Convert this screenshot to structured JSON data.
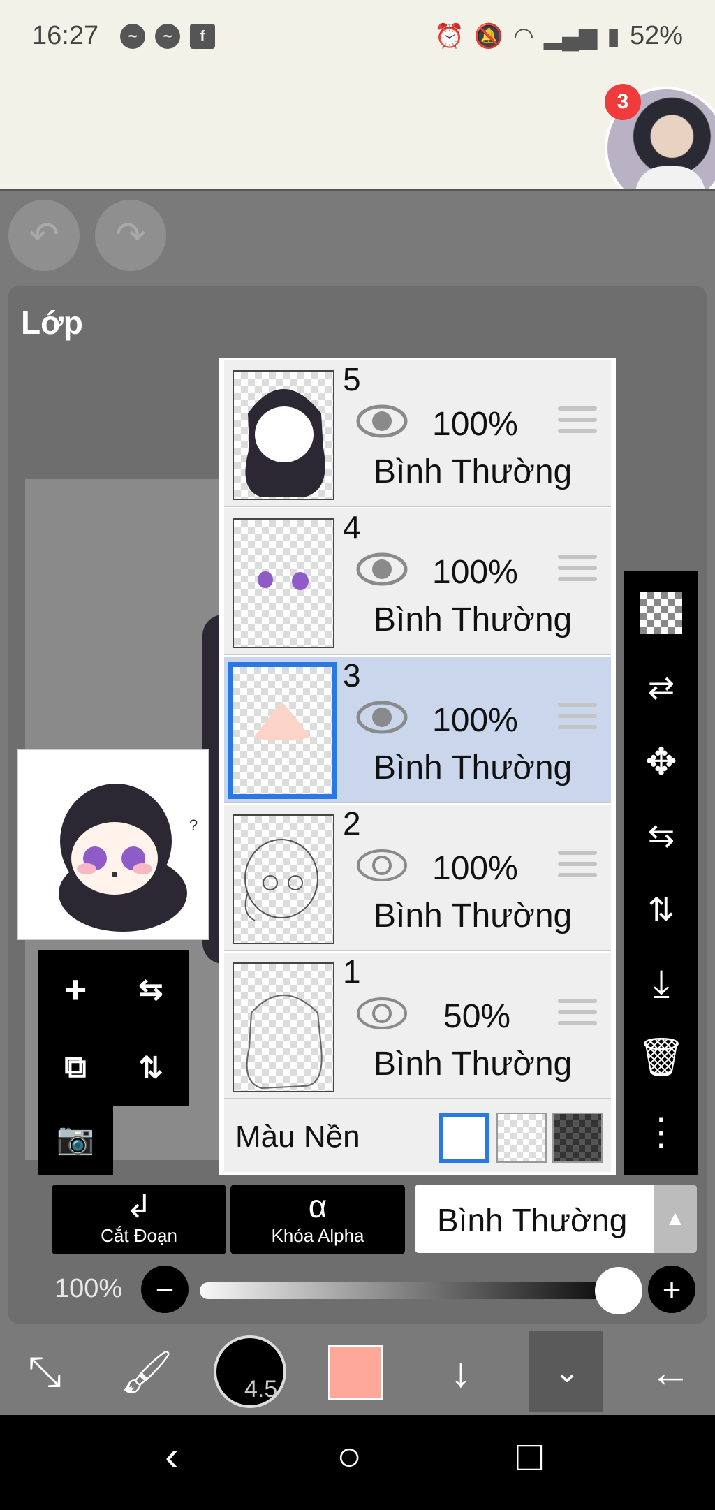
{
  "status_bar": {
    "time": "16:27",
    "left_icons": [
      "messenger-icon",
      "messenger-icon",
      "facebook-icon"
    ],
    "right_icons": [
      "alarm-icon",
      "mute-icon",
      "wifi-icon",
      "signal-icon",
      "battery-icon"
    ],
    "battery": "52%"
  },
  "chat_head": {
    "badge_count": "3"
  },
  "header": {
    "title": "Lớp"
  },
  "layers": [
    {
      "number": "5",
      "opacity": "100%",
      "blend": "Bình Thường",
      "visible": true,
      "selected": false
    },
    {
      "number": "4",
      "opacity": "100%",
      "blend": "Bình Thường",
      "visible": true,
      "selected": false
    },
    {
      "number": "3",
      "opacity": "100%",
      "blend": "Bình Thường",
      "visible": true,
      "selected": true
    },
    {
      "number": "2",
      "opacity": "100%",
      "blend": "Bình Thường",
      "visible": false,
      "selected": false
    },
    {
      "number": "1",
      "opacity": "50%",
      "blend": "Bình Thường",
      "visible": false,
      "selected": false
    }
  ],
  "background": {
    "label": "Màu Nền",
    "options": [
      "white",
      "transparent",
      "dark"
    ],
    "selected": "white"
  },
  "actions": {
    "clipping_label": "Cắt Đoạn",
    "alpha_lock_label": "Khóa Alpha",
    "blend_mode": "Bình Thường"
  },
  "opacity_slider": {
    "label": "100%",
    "value": 1.0
  },
  "brush": {
    "size": "4.5",
    "color": "#fda89a"
  },
  "colors": {
    "accent": "#2a78e4",
    "selected_row": "#c9d6ec",
    "badge": "#ef3b3b"
  }
}
